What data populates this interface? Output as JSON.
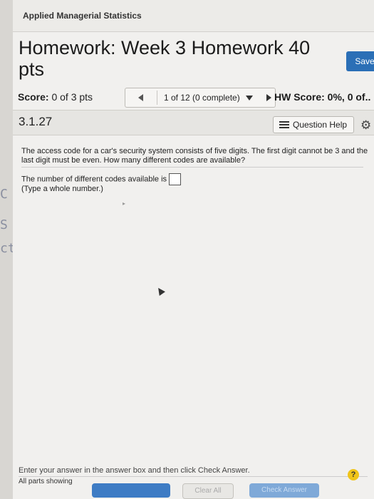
{
  "course": {
    "title": "Applied Managerial Statistics"
  },
  "homework": {
    "title": "Homework: Week 3 Homework 40 pts",
    "save_label": "Save"
  },
  "score": {
    "label": "Score:",
    "value": "0 of 3 pts"
  },
  "navigation": {
    "position_text": "1 of 12 (0 complete)"
  },
  "hw_score": {
    "text": "HW Score: 0%, 0 of.."
  },
  "question": {
    "number": "3.1.27",
    "help_label": "Question Help",
    "text": "The access code for a car's security system consists of five digits. The first digit cannot be 3 and the last digit must be even. How many different codes are available?",
    "prompt": "The number of different codes available is",
    "answer_value": "",
    "hint": "(Type a whole number.)"
  },
  "side_letters": [
    "C",
    "S",
    "ct"
  ],
  "footer": {
    "instruction": "Enter your answer in the answer box and then click Check Answer.",
    "parts_label": "All parts showing",
    "clear_label": "Clear All",
    "check_label": "Check Answer",
    "help_glyph": "?"
  },
  "icons": {
    "prev": "triangle-left-icon",
    "next": "triangle-right-icon",
    "caret": "caret-down-icon",
    "help": "list-icon",
    "gear": "gear-icon"
  },
  "colors": {
    "accent": "#2b6fb6",
    "help_yellow": "#f0c419"
  }
}
